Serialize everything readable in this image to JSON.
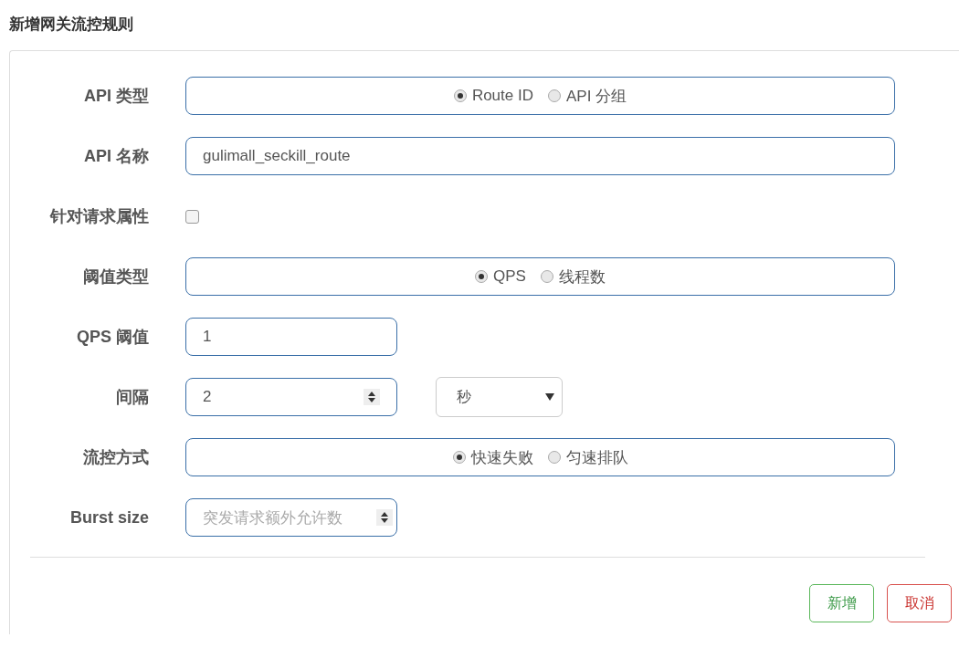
{
  "title": "新增网关流控规则",
  "fields": [
    {
      "kind": "radio",
      "label": "API 类型",
      "options": [
        {
          "label": "Route ID",
          "selected": true
        },
        {
          "label": "API 分组",
          "selected": false
        }
      ]
    },
    {
      "kind": "text",
      "label": "API 名称",
      "value": "gulimall_seckill_route"
    },
    {
      "kind": "checkbox",
      "label": "针对请求属性",
      "checked": false
    },
    {
      "kind": "radio",
      "label": "阈值类型",
      "options": [
        {
          "label": "QPS",
          "selected": true
        },
        {
          "label": "线程数",
          "selected": false
        }
      ]
    },
    {
      "kind": "short",
      "label": "QPS 阈值",
      "value": "1"
    },
    {
      "kind": "interval",
      "label": "间隔",
      "value": "2",
      "unit": "秒"
    },
    {
      "kind": "radio",
      "label": "流控方式",
      "options": [
        {
          "label": "快速失败",
          "selected": true
        },
        {
          "label": "匀速排队",
          "selected": false
        }
      ]
    },
    {
      "kind": "number",
      "label": "Burst size",
      "placeholder": "突发请求额外允许数"
    }
  ],
  "buttons": [
    {
      "label": "新增",
      "kind": "confirm"
    },
    {
      "label": "取消",
      "kind": "cancel"
    }
  ]
}
